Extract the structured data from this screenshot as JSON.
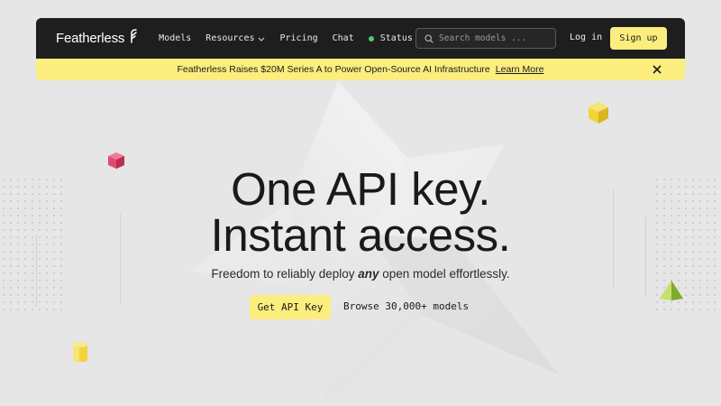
{
  "brand": {
    "name": "Featherless",
    "accent": "#fbee7e",
    "nav_bg": "#1e1e1e"
  },
  "nav": {
    "links": [
      {
        "label": "Models"
      },
      {
        "label": "Resources"
      },
      {
        "label": "Pricing"
      },
      {
        "label": "Chat"
      },
      {
        "label": "Status"
      }
    ],
    "search_placeholder": "Search models ...",
    "login_label": "Log in",
    "signup_label": "Sign up"
  },
  "banner": {
    "text": "Featherless Raises $20M Series A to Power Open-Source AI Infrastructure",
    "link_label": "Learn More"
  },
  "hero": {
    "title_line1": "One API key.",
    "title_line2": "Instant access.",
    "subtitle_pre": "Freedom to reliably deploy ",
    "subtitle_em": "any",
    "subtitle_post": " open model effortlessly.",
    "primary_cta": "Get API Key",
    "secondary_cta": "Browse 30,000+ models"
  },
  "icons": [
    "featherless-logo-icon",
    "chevron-down-icon",
    "status-dot-icon",
    "search-icon",
    "close-icon"
  ]
}
